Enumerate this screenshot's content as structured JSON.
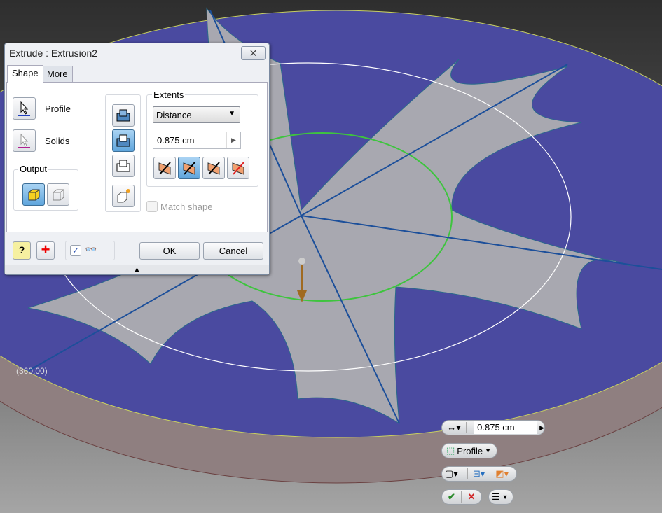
{
  "dialog": {
    "title": "Extrude : Extrusion2",
    "tabs": [
      {
        "label": "Shape"
      },
      {
        "label": "More"
      }
    ],
    "profile_label": "Profile",
    "solids_label": "Solids",
    "output_label": "Output",
    "extents_label": "Extents",
    "extents_type": "Distance",
    "distance_value": "0.875 cm",
    "match_shape_label": "Match shape",
    "match_shape_checked": false,
    "preview_checked": true,
    "ok_label": "OK",
    "cancel_label": "Cancel"
  },
  "viewport": {
    "angle_label": "(360.00)"
  },
  "minitoolbar": {
    "distance_value": "0.875 cm",
    "profile_label": "Profile"
  },
  "colors": {
    "disk": "#4a4aa0",
    "profile": "#a8a8b0",
    "sketch_line": "#1c4f9a",
    "green_circle": "#3ec43e",
    "ok_green": "#2a8a2a",
    "cancel_red": "#d02020"
  }
}
